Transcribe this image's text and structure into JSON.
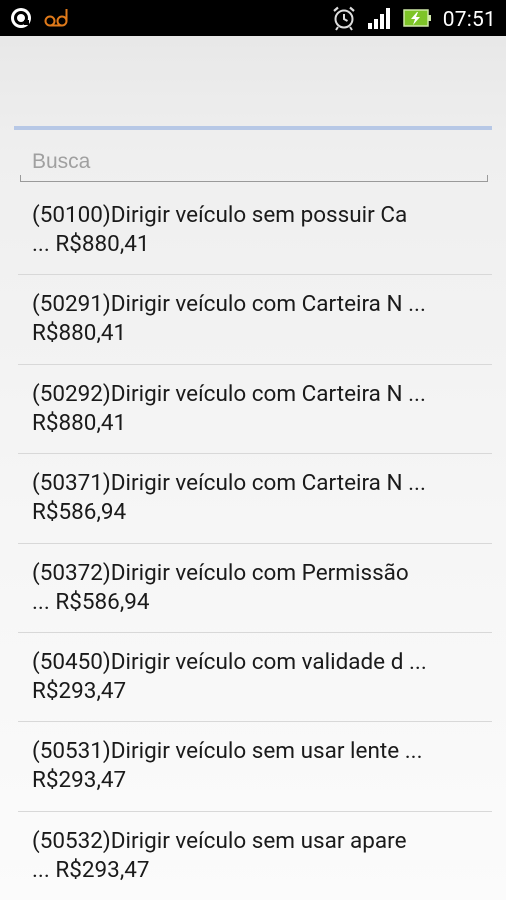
{
  "status_bar": {
    "time": "07:51",
    "left_icons": [
      "opera-icon",
      "voicemail-icon"
    ],
    "right_icons": [
      "alarm-icon",
      "signal-icon",
      "battery-charging-icon"
    ]
  },
  "search": {
    "placeholder": "Busca",
    "value": ""
  },
  "items": [
    {
      "line1": "(50100)Dirigir veículo sem possuir Ca",
      "line2": "... R$880,41"
    },
    {
      "line1": "(50291)Dirigir veículo com Carteira N ...",
      "line2": "R$880,41"
    },
    {
      "line1": "(50292)Dirigir veículo com Carteira N ...",
      "line2": "R$880,41"
    },
    {
      "line1": "(50371)Dirigir veículo com Carteira N ...",
      "line2": "R$586,94"
    },
    {
      "line1": "(50372)Dirigir veículo com Permissão",
      "line2": "... R$586,94"
    },
    {
      "line1": "(50450)Dirigir veículo com validade d ...",
      "line2": "R$293,47"
    },
    {
      "line1": "(50531)Dirigir veículo sem usar lente ...",
      "line2": "R$293,47"
    },
    {
      "line1": "(50532)Dirigir veículo sem usar apare",
      "line2": "... R$293,47"
    }
  ],
  "colors": {
    "status_bar_bg": "#000000",
    "accent_rule": "#b7c8e6",
    "battery_green": "#7ec428",
    "opera_orange": "#e07a1a"
  }
}
